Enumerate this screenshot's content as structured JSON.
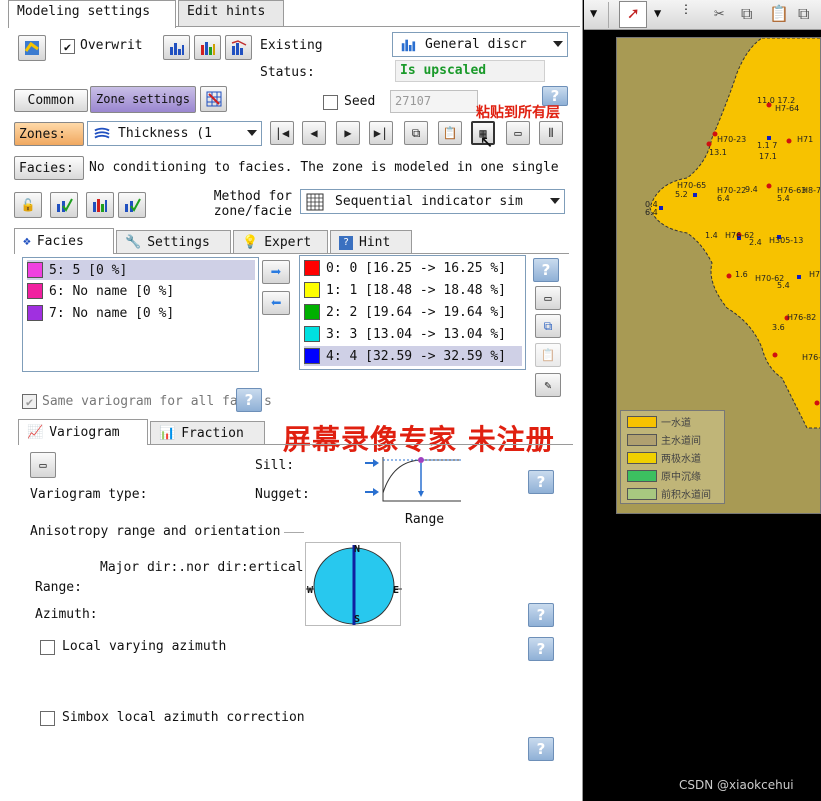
{
  "tabs_top": [
    "Modeling settings",
    "Edit hints"
  ],
  "row1": {
    "overwrite_label": "Overwrit",
    "existing_label": "Existing",
    "status_label": "Status:",
    "status_value": "Is upscaled",
    "general_combo": "General discr"
  },
  "row2": {
    "common_btn": "Common",
    "zone_settings_btn": "Zone settings",
    "seed_label": "Seed",
    "seed_value": "27107"
  },
  "overlay_red_text": "粘贴到所有层",
  "zones": {
    "label": "Zones:",
    "value": "Thickness (1"
  },
  "facies_cond": {
    "label": "Facies:",
    "text": "No conditioning to facies. The zone is modeled in one single"
  },
  "method": {
    "label": "Method for zone/facie",
    "value": "Sequential indicator sim"
  },
  "inner_tabs": [
    "Facies",
    "Settings",
    "Expert",
    "Hint"
  ],
  "left_list": [
    {
      "text": "5: 5 [0 %]",
      "color": "#f040e0",
      "selected": true
    },
    {
      "text": "6: No name [0 %]",
      "color": "#f020a0",
      "selected": false
    },
    {
      "text": "7: No name [0 %]",
      "color": "#a030e0",
      "selected": false
    }
  ],
  "right_list": [
    {
      "text": "0: 0 [16.25 -> 16.25 %]",
      "color": "#ff0000"
    },
    {
      "text": "1: 1 [18.48 -> 18.48 %]",
      "color": "#ffff00"
    },
    {
      "text": "2: 2 [19.64 -> 19.64 %]",
      "color": "#00b000"
    },
    {
      "text": "3: 3 [13.04 -> 13.04 %]",
      "color": "#00e0e0"
    },
    {
      "text": "4: 4 [32.59 -> 32.59 %]",
      "color": "#0000ff"
    }
  ],
  "same_variogram": "Same variogram for all fa",
  "same_variogram_tail": "s",
  "watermark": "屏幕录像专家  未注册",
  "vario_tabs": [
    "Variogram",
    "Fraction"
  ],
  "variogram": {
    "sill": "Sill:",
    "nugget": "Nugget:",
    "type": "Variogram type:",
    "range": "Range",
    "aniso": "Anisotropy range and orientation",
    "dirs": "Major dir:.nor dir:ertical",
    "range_label": "Range:",
    "azimuth_label": "Azimuth:",
    "compass": {
      "n": "N",
      "s": "S",
      "e": "E",
      "w": "W"
    },
    "local_azimuth": "Local varying azimuth",
    "simbox": "Simbox local azimuth correction"
  },
  "map_legend": [
    "一水道",
    "主水道间",
    "两极水道",
    "原中沉缘",
    "前积水道间"
  ],
  "map_labels": [
    "11.0 17.2",
    "H7-64",
    "H70-23",
    "1.1 7",
    "H71",
    "13.1",
    "17.1",
    "H70-65",
    "5.2",
    "H70-22",
    "6.4",
    "9.4",
    "H76-63",
    "5.4",
    "H8-79",
    "0.4",
    "6.4",
    "1.4",
    "H76-62",
    "2.4",
    "H305-13",
    "1.6",
    "H70-62",
    "H7",
    "5.4",
    "H76-82",
    "3.6",
    "H76-62"
  ],
  "colors": {
    "map_bg": "#a89a54",
    "map_fill": "#f7c200",
    "watermark": "#e02010",
    "accent_blue": "#2a5fb0"
  },
  "credit": "CSDN @xiaokcehui"
}
